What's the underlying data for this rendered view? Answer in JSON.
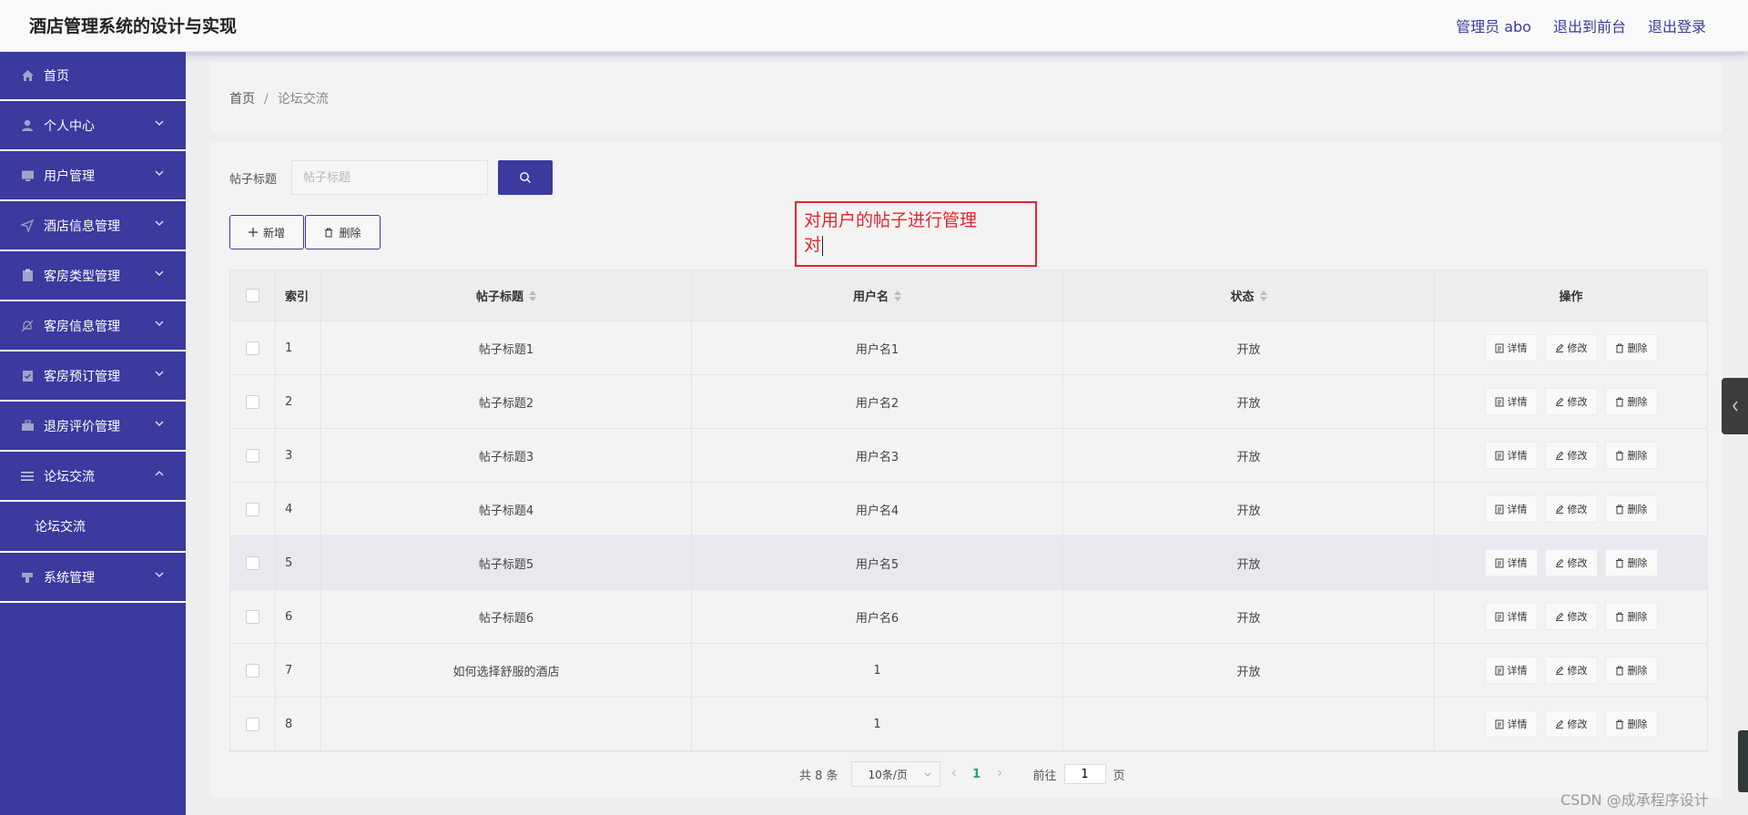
{
  "app": {
    "title": "酒店管理系统的设计与实现"
  },
  "header": {
    "user_label": "管理员 abo",
    "front_link": "退出到前台",
    "logout_link": "退出登录"
  },
  "sidebar": {
    "items": [
      {
        "label": "首页",
        "icon": "home-icon"
      },
      {
        "label": "个人中心",
        "icon": "user-icon"
      },
      {
        "label": "用户管理",
        "icon": "monitor-icon"
      },
      {
        "label": "酒店信息管理",
        "icon": "send-icon"
      },
      {
        "label": "客房类型管理",
        "icon": "clipboard-icon"
      },
      {
        "label": "客房信息管理",
        "icon": "bell-off-icon"
      },
      {
        "label": "客房预订管理",
        "icon": "checklist-icon"
      },
      {
        "label": "退房评价管理",
        "icon": "suitcase-icon"
      },
      {
        "label": "论坛交流",
        "icon": "menu-icon"
      },
      {
        "label": "系统管理",
        "icon": "stamp-icon"
      }
    ],
    "sub_item": "论坛交流"
  },
  "breadcrumb": {
    "home": "首页",
    "separator": "/",
    "current": "论坛交流"
  },
  "search": {
    "label": "帖子标题",
    "placeholder": "帖子标题",
    "value": ""
  },
  "toolbar": {
    "add_label": "新增",
    "delete_label": "删除"
  },
  "annotation": {
    "line1": "对用户的帖子进行管理",
    "line2": "对"
  },
  "table": {
    "columns": {
      "index": "索引",
      "title": "帖子标题",
      "username": "用户名",
      "status": "状态",
      "actions": "操作"
    },
    "action_labels": {
      "detail": "详情",
      "edit": "修改",
      "delete": "删除"
    },
    "rows": [
      {
        "index": "1",
        "title": "帖子标题1",
        "username": "用户名1",
        "status": "开放"
      },
      {
        "index": "2",
        "title": "帖子标题2",
        "username": "用户名2",
        "status": "开放"
      },
      {
        "index": "3",
        "title": "帖子标题3",
        "username": "用户名3",
        "status": "开放"
      },
      {
        "index": "4",
        "title": "帖子标题4",
        "username": "用户名4",
        "status": "开放"
      },
      {
        "index": "5",
        "title": "帖子标题5",
        "username": "用户名5",
        "status": "开放"
      },
      {
        "index": "6",
        "title": "帖子标题6",
        "username": "用户名6",
        "status": "开放"
      },
      {
        "index": "7",
        "title": "如何选择舒服的酒店",
        "username": "1",
        "status": "开放"
      },
      {
        "index": "8",
        "title": "",
        "username": "1",
        "status": ""
      }
    ]
  },
  "pagination": {
    "total": "共 8 条",
    "page_size": "10条/页",
    "current_page": "1",
    "goto_prefix": "前往",
    "goto_value": "1",
    "goto_suffix": "页"
  },
  "watermark": "CSDN @成承程序设计",
  "colors": {
    "primary": "#3a3a9f",
    "annotation": "#e52530",
    "active_page": "#28a26b"
  }
}
